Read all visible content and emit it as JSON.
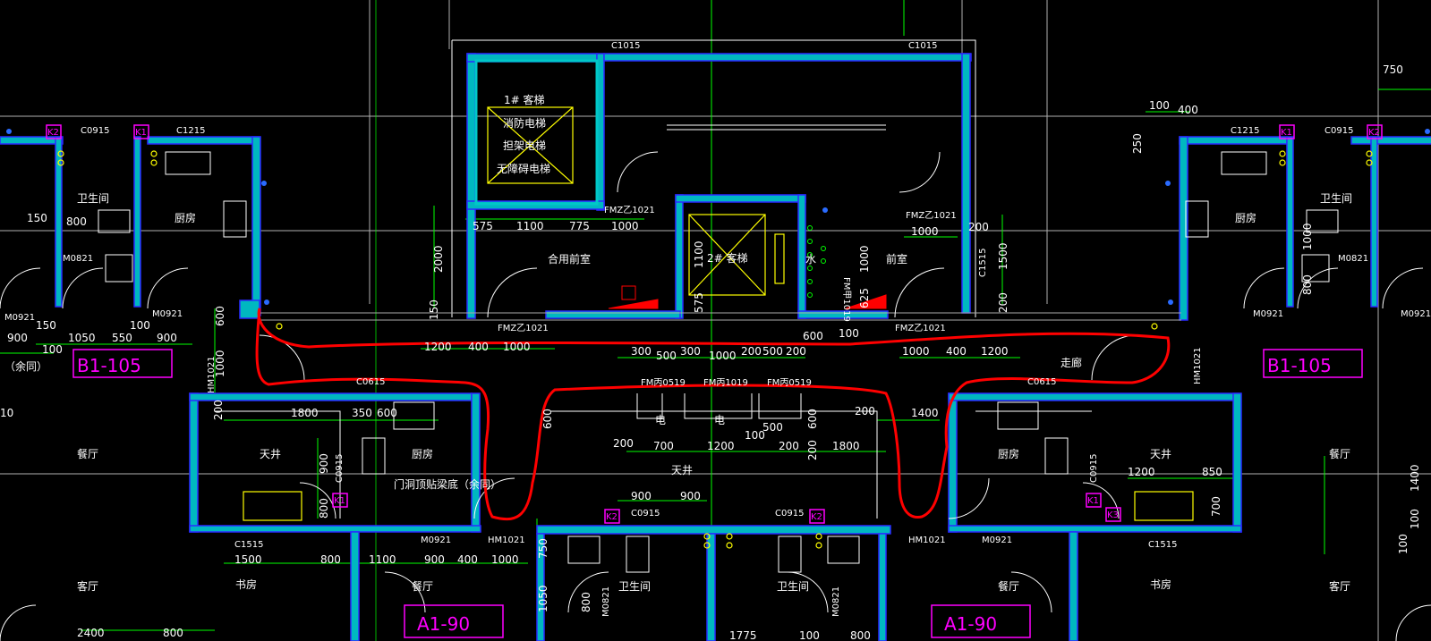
{
  "colors": {
    "background": "#000000",
    "wall_fill": "#00c8c8",
    "wall_outline": "#3a3aff",
    "dimension": "#00ff00",
    "grid": "#ffffff",
    "elevator": "#ffff00",
    "tag": "#ff00ff",
    "markup": "#ff0000",
    "lightgreen": "#00ff00"
  },
  "windows": {
    "c1015_left": "C1015",
    "c1015_right": "C1015",
    "c0915_ul": "C0915",
    "c1215_ul": "C1215",
    "c1215_ur": "C1215",
    "c0915_ur": "C0915",
    "c0615_l": "C0615",
    "c0615_r": "C0615",
    "c0915_bl": "C0915",
    "c0915_br": "C0915",
    "c1515_l": "C1515",
    "c1515_r": "C1515",
    "k2_ul": "K2",
    "k1_ul": "K1",
    "k1_ur": "K1",
    "k2_ur": "K2",
    "k1_ml": "K1",
    "k1_mr": "K1",
    "k3_mr": "K3",
    "k2_bl": "K2",
    "k2_br": "K2"
  },
  "doors": {
    "fmy1021_a": "FMZ乙1021",
    "fmy1021_b": "FMZ乙1021",
    "fmy1021_c": "FMZ乙1021",
    "fmy1021_d": "FMZ乙1021",
    "m0821_l": "M0821",
    "m0821_r": "M0821",
    "m0921_a": "M0921",
    "m0921_b": "M0921",
    "m0921_c": "M0921",
    "m0921_d": "M0921",
    "m0921_e": "M0921",
    "m0921_f": "M0921",
    "hm1021_l": "HM1021",
    "hm1021_r": "HM1021",
    "hm1021_m": "HM1021",
    "hm1021_n": "HM1021",
    "fm1019": "FM丙1019",
    "fm0519_a": "FM丙0519",
    "fm0519_b": "FM丙0519",
    "fmjia1019": "FM甲1019",
    "c1515_v": "C1515",
    "m0821_v": "M0821",
    "m0821_v2": "M0821",
    "c0915_v": "C0915",
    "c0915_v2": "C0915"
  },
  "rooms": {
    "elev_title": "1# 客梯",
    "elev_fire": "消防电梯",
    "elev_stretcher": "担架电梯",
    "elev_barrier": "无障碍电梯",
    "elev2": "2# 客梯",
    "lobby_shared": "合用前室",
    "lobby": "前室",
    "water": "水",
    "bath_ul": "卫生间",
    "kitchen_ul": "厨房",
    "bath_ur": "卫生间",
    "kitchen_ur": "厨房",
    "dining_l": "餐厅",
    "dining_r": "餐厅",
    "skywell_l": "天井",
    "skywell_m": "天井",
    "skywell_r": "天井",
    "kitchen_ml": "厨房",
    "kitchen_mr": "厨房",
    "living_l": "客厅",
    "living_r": "客厅",
    "study_l": "书房",
    "study_r": "书房",
    "dining_bl": "餐厅",
    "dining_br": "餐厅",
    "bath_bl": "卫生间",
    "bath_br": "卫生间",
    "corridor": "走廊",
    "beam_note": "门洞顶贴梁底（余同）",
    "elec1": "电",
    "elec2": "电",
    "same_note": "（余同）",
    "unit_ul": "B1-105",
    "unit_ur": "B1-105",
    "unit_bl": "A1-90",
    "unit_br": "A1-90"
  },
  "dims": {
    "d575": "575",
    "d1100": "1100",
    "d775": "775",
    "d1000a": "1000",
    "d2000": "2000",
    "d150a": "150",
    "d1100v": "1100",
    "d575v": "575",
    "d1000v": "1000",
    "d625v": "625",
    "d1000b": "1000",
    "d200a": "200",
    "d1500v": "1500",
    "d200v": "200",
    "d600": "600",
    "d100a": "100",
    "d1200a": "1200",
    "d400a": "400",
    "d1000c": "1000",
    "d300a": "300",
    "d500a": "500",
    "d300b": "300",
    "d1000d": "1000",
    "d200b": "200",
    "d500b": "500",
    "d200c": "200",
    "d1000e": "1000",
    "d400b": "400",
    "d1200b": "1200",
    "d150b": "150",
    "d800": "800",
    "d150c": "150",
    "d100b": "100",
    "d900a": "900",
    "d1050": "1050",
    "d550": "550",
    "d900b": "900",
    "d100c": "100",
    "d600v": "600",
    "d1000f": "1000",
    "d100d": "100",
    "d400c": "400",
    "d250": "250",
    "d750": "750",
    "d1800a": "1800",
    "d350": "350",
    "d600b": "600",
    "d200d": "200",
    "d900v": "900",
    "d800v": "800",
    "d1500a": "1500",
    "d800b": "800",
    "d1100b": "1100",
    "d900c": "900",
    "d400d": "400",
    "d1000g": "1000",
    "d750v": "750",
    "d1050v": "1050",
    "d800v2": "800",
    "d2400": "2400",
    "d800c": "800",
    "d200e": "200",
    "d700": "700",
    "d1200c": "1200",
    "d200f": "200",
    "d1800b": "1800",
    "d900d": "900",
    "d900e": "900",
    "d100e": "100",
    "d500c": "500",
    "d600c": "600",
    "d200g": "200",
    "d1400": "1400",
    "d1200d": "1200",
    "d850": "850",
    "d700v": "700",
    "d1400v": "1400",
    "d100f": "100",
    "d100g": "100",
    "d1775": "1775",
    "d100h": "100",
    "d800d": "800",
    "d10": "10",
    "d1500b": "1500"
  }
}
